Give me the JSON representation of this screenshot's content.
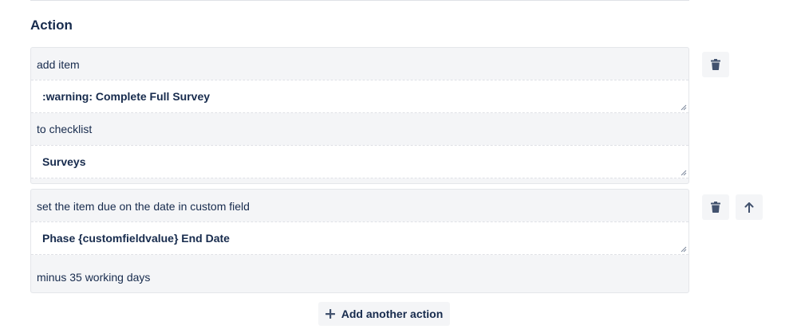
{
  "section": {
    "title": "Action"
  },
  "actions": [
    {
      "rows": [
        {
          "type": "text",
          "value": "add item"
        },
        {
          "type": "field",
          "value": ":warning: Complete Full Survey"
        },
        {
          "type": "text",
          "value": "to checklist"
        },
        {
          "type": "field",
          "value": "Surveys"
        }
      ],
      "buttons": [
        "trash-icon"
      ]
    },
    {
      "rows": [
        {
          "type": "text",
          "value": "set the item due on the date in custom field"
        },
        {
          "type": "field",
          "value": "Phase {customfieldvalue} End Date"
        },
        {
          "type": "text",
          "value": "minus 35 working days"
        }
      ],
      "buttons": [
        "trash-icon",
        "arrow-up-icon"
      ]
    }
  ],
  "add_action": {
    "label": "Add another action",
    "icon": "plus-icon"
  },
  "colors": {
    "card_bg": "#f4f5f7",
    "text": "#172b4d",
    "field_bg": "#ffffff"
  }
}
